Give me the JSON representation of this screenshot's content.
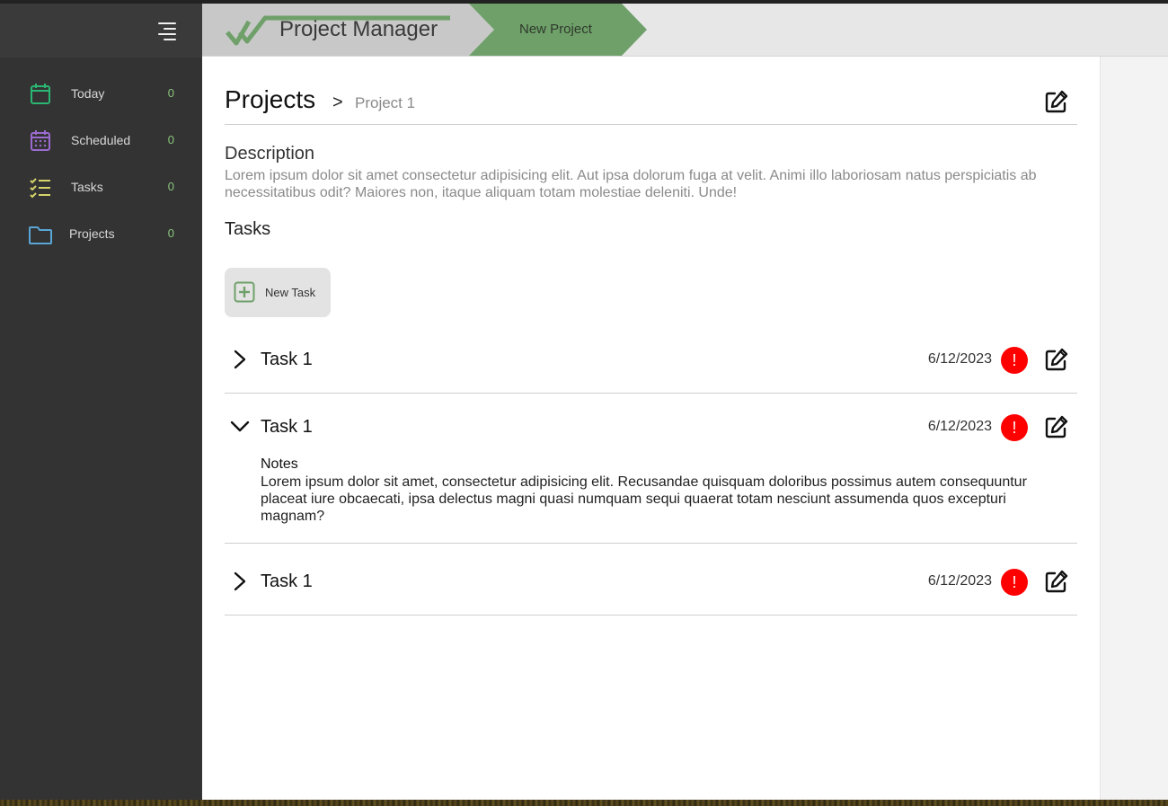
{
  "app": {
    "title": "Project Manager",
    "accent_color": "#6fa06a"
  },
  "header": {
    "crumb_tab": "New Project"
  },
  "sidebar": {
    "menu_icon": "menu-icon",
    "items": [
      {
        "label": "Today",
        "count": "0",
        "icon": "calendar-icon",
        "color": "#2bb673"
      },
      {
        "label": "Scheduled",
        "count": "0",
        "icon": "calendar-grid-icon",
        "color": "#9b6bd1"
      },
      {
        "label": "Tasks",
        "count": "0",
        "icon": "checklist-icon",
        "color": "#d6d46a"
      },
      {
        "label": "Projects",
        "count": "0",
        "icon": "folder-icon",
        "color": "#5aa6d6"
      }
    ]
  },
  "main": {
    "title": "Projects",
    "crumb_separator": ">",
    "crumb_current": "Project 1",
    "description_heading": "Description",
    "description_text": "Lorem ipsum dolor sit amet consectetur adipisicing elit. Aut ipsa dolorum fuga at velit. Animi illo laboriosam natus perspiciatis ab necessitatibus odit? Maiores non, itaque aliquam totam molestiae deleniti. Unde!",
    "tasks_heading": "Tasks",
    "new_task_label": "New Task"
  },
  "tasks": [
    {
      "title": "Task 1",
      "date": "6/12/2023",
      "alert": "!",
      "expanded": false
    },
    {
      "title": "Task 1",
      "date": "6/12/2023",
      "alert": "!",
      "expanded": true,
      "notes_title": "Notes",
      "notes_text": "Lorem ipsum dolor sit amet, consectetur adipisicing elit. Recusandae quisquam doloribus possimus autem consequuntur placeat iure obcaecati, ipsa delectus magni quasi numquam sequi quaerat totam nesciunt assumenda quos excepturi magnam?"
    },
    {
      "title": "Task 1",
      "date": "6/12/2023",
      "alert": "!",
      "expanded": false
    }
  ]
}
